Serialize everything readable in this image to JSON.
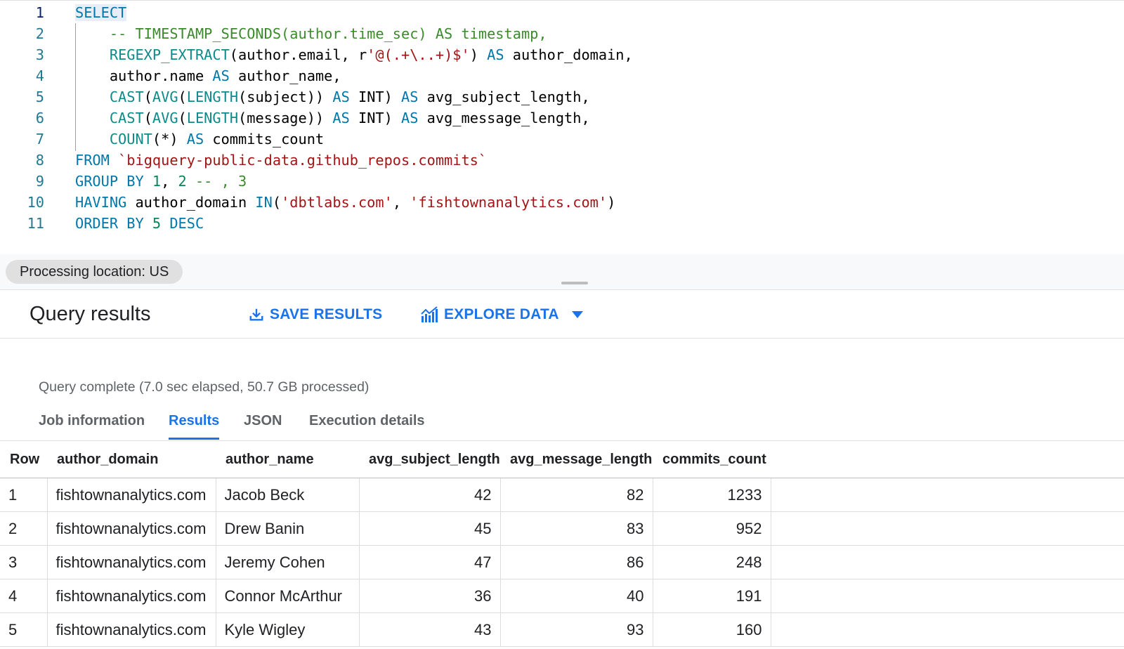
{
  "editor": {
    "lines": [
      {
        "n": "1",
        "tokens": [
          {
            "t": "SELECT",
            "c": "t-kw"
          }
        ]
      },
      {
        "n": "2",
        "tokens": [
          {
            "t": "    -- TIMESTAMP_SECONDS(author.time_sec) AS timestamp,",
            "c": "t-cm"
          }
        ]
      },
      {
        "n": "3",
        "tokens": [
          {
            "t": "    ",
            "c": "t-id"
          },
          {
            "t": "REGEXP_EXTRACT",
            "c": "t-fn"
          },
          {
            "t": "(author.email, r",
            "c": "t-id"
          },
          {
            "t": "'@(.+\\..+)$'",
            "c": "t-str"
          },
          {
            "t": ") ",
            "c": "t-id"
          },
          {
            "t": "AS",
            "c": "t-kw"
          },
          {
            "t": " author_domain,",
            "c": "t-id"
          }
        ]
      },
      {
        "n": "4",
        "tokens": [
          {
            "t": "    author.name ",
            "c": "t-id"
          },
          {
            "t": "AS",
            "c": "t-kw"
          },
          {
            "t": " author_name,",
            "c": "t-id"
          }
        ]
      },
      {
        "n": "5",
        "tokens": [
          {
            "t": "    ",
            "c": "t-id"
          },
          {
            "t": "CAST",
            "c": "t-fn"
          },
          {
            "t": "(",
            "c": "t-id"
          },
          {
            "t": "AVG",
            "c": "t-fn"
          },
          {
            "t": "(",
            "c": "t-id"
          },
          {
            "t": "LENGTH",
            "c": "t-fn"
          },
          {
            "t": "(subject)) ",
            "c": "t-id"
          },
          {
            "t": "AS",
            "c": "t-kw"
          },
          {
            "t": " INT) ",
            "c": "t-id"
          },
          {
            "t": "AS",
            "c": "t-kw"
          },
          {
            "t": " avg_subject_length,",
            "c": "t-id"
          }
        ]
      },
      {
        "n": "6",
        "tokens": [
          {
            "t": "    ",
            "c": "t-id"
          },
          {
            "t": "CAST",
            "c": "t-fn"
          },
          {
            "t": "(",
            "c": "t-id"
          },
          {
            "t": "AVG",
            "c": "t-fn"
          },
          {
            "t": "(",
            "c": "t-id"
          },
          {
            "t": "LENGTH",
            "c": "t-fn"
          },
          {
            "t": "(message)) ",
            "c": "t-id"
          },
          {
            "t": "AS",
            "c": "t-kw"
          },
          {
            "t": " INT) ",
            "c": "t-id"
          },
          {
            "t": "AS",
            "c": "t-kw"
          },
          {
            "t": " avg_message_length,",
            "c": "t-id"
          }
        ]
      },
      {
        "n": "7",
        "tokens": [
          {
            "t": "    ",
            "c": "t-id"
          },
          {
            "t": "COUNT",
            "c": "t-fn"
          },
          {
            "t": "(*) ",
            "c": "t-id"
          },
          {
            "t": "AS",
            "c": "t-kw"
          },
          {
            "t": " commits_count",
            "c": "t-id"
          }
        ]
      },
      {
        "n": "8",
        "tokens": [
          {
            "t": "FROM",
            "c": "t-kw"
          },
          {
            "t": " ",
            "c": "t-id"
          },
          {
            "t": "`bigquery-public-data.github_repos.commits`",
            "c": "t-str"
          }
        ]
      },
      {
        "n": "9",
        "tokens": [
          {
            "t": "GROUP BY",
            "c": "t-kw"
          },
          {
            "t": " ",
            "c": "t-id"
          },
          {
            "t": "1",
            "c": "t-num"
          },
          {
            "t": ", ",
            "c": "t-id"
          },
          {
            "t": "2",
            "c": "t-num"
          },
          {
            "t": " -- , 3",
            "c": "t-cm"
          }
        ]
      },
      {
        "n": "10",
        "tokens": [
          {
            "t": "HAVING",
            "c": "t-kw"
          },
          {
            "t": " author_domain ",
            "c": "t-id"
          },
          {
            "t": "IN",
            "c": "t-kw"
          },
          {
            "t": "(",
            "c": "t-id"
          },
          {
            "t": "'dbtlabs.com'",
            "c": "t-str"
          },
          {
            "t": ", ",
            "c": "t-id"
          },
          {
            "t": "'fishtownanalytics.com'",
            "c": "t-str"
          },
          {
            "t": ")",
            "c": "t-id"
          }
        ]
      },
      {
        "n": "11",
        "tokens": [
          {
            "t": "ORDER BY",
            "c": "t-kw"
          },
          {
            "t": " ",
            "c": "t-id"
          },
          {
            "t": "5",
            "c": "t-num"
          },
          {
            "t": " ",
            "c": "t-id"
          },
          {
            "t": "DESC",
            "c": "t-kw"
          }
        ]
      }
    ]
  },
  "processing_location": "Processing location: US",
  "toolbar": {
    "title": "Query results",
    "save_label": "SAVE RESULTS",
    "explore_label": "EXPLORE DATA"
  },
  "status_text": "Query complete (7.0 sec elapsed, 50.7 GB processed)",
  "tabs": [
    "Job information",
    "Results",
    "JSON",
    "Execution details"
  ],
  "active_tab": "Results",
  "table": {
    "columns": [
      "Row",
      "author_domain",
      "author_name",
      "avg_subject_length",
      "avg_message_length",
      "commits_count"
    ],
    "rows": [
      [
        "1",
        "fishtownanalytics.com",
        "Jacob Beck",
        "42",
        "82",
        "1233"
      ],
      [
        "2",
        "fishtownanalytics.com",
        "Drew Banin",
        "45",
        "83",
        "952"
      ],
      [
        "3",
        "fishtownanalytics.com",
        "Jeremy Cohen",
        "47",
        "86",
        "248"
      ],
      [
        "4",
        "fishtownanalytics.com",
        "Connor McArthur",
        "36",
        "40",
        "191"
      ],
      [
        "5",
        "fishtownanalytics.com",
        "Kyle Wigley",
        "43",
        "93",
        "160"
      ]
    ]
  },
  "colors": {
    "accent": "#1a73e8",
    "keyword": "#0077aa",
    "function": "#0e8a8a",
    "string": "#a31515",
    "comment": "#3b8a2b"
  },
  "icons": {
    "save": "download-icon",
    "explore": "chart-icon",
    "dropdown": "caret-down-icon"
  }
}
